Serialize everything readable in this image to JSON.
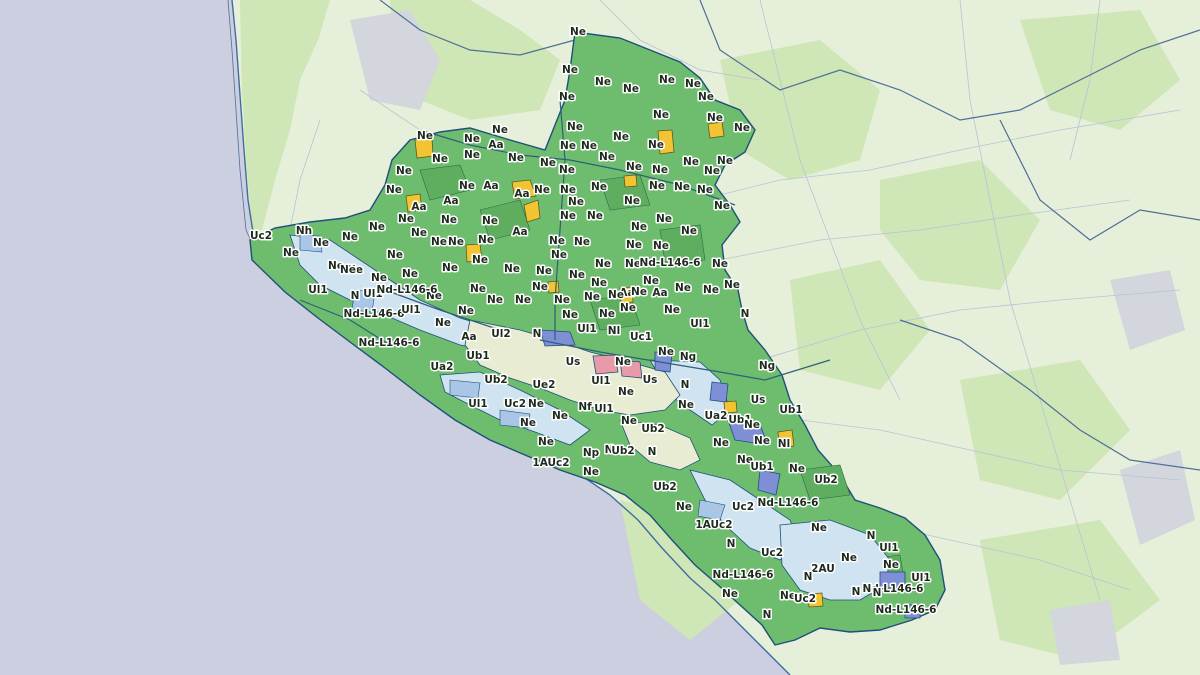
{
  "colors": {
    "sea": "#cbcfdf",
    "land": "#e6efd9",
    "vegetation": "#cfe6b6",
    "zone_N": "#6ebd6e",
    "zone_A": "#f2c433",
    "zone_U_light": "#cfe3f0",
    "zone_U_mid": "#a9c6e6",
    "zone_U_dark": "#7f8fd6",
    "zone_Ub": "#e8ecd2",
    "zone_special": "#e89aa9",
    "boundary": "#1f4f7a"
  },
  "zone_labels": [
    "Ne",
    "Ne",
    "Ne",
    "Ne",
    "Ne",
    "Ne",
    "Ne",
    "Ne",
    "Ne",
    "Ne",
    "Ne",
    "Ne",
    "Ne",
    "Ne",
    "Ne",
    "Ne",
    "Ne",
    "Ne",
    "Ne",
    "Aa",
    "Ne",
    "Ne",
    "Ne",
    "Ne",
    "Ne",
    "Ne",
    "Ne",
    "Ne",
    "Ne",
    "Ne",
    "Ne",
    "Ne",
    "Ne",
    "Aa",
    "Ne",
    "Aa",
    "Ne",
    "Ne",
    "Ne",
    "Aa",
    "Ne",
    "Ne",
    "Ne",
    "Aa",
    "Aa",
    "Ne",
    "Ne",
    "Ne",
    "Ne",
    "Ne",
    "Ne",
    "Ne",
    "Ne",
    "Ne",
    "Ne",
    "Ne",
    "Ne",
    "Ne",
    "Ne",
    "Ne",
    "Ne",
    "Ne",
    "Ne",
    "Ne",
    "Ne",
    "Ne",
    "Ne",
    "Ne",
    "Ne",
    "Ne",
    "Ne",
    "Ne",
    "Nd-L146-6",
    "Ne",
    "Ne",
    "Ne",
    "Ne",
    "Ne",
    "Ne",
    "Ne",
    "Ne",
    "Ne",
    "Ne",
    "Ne",
    "Ne",
    "Ne",
    "Ne",
    "Aa",
    "Ne",
    "Aa",
    "Ne",
    "Ne",
    "Ne",
    "Ne",
    "Ne",
    "Ne",
    "Ne",
    "Ne",
    "Ne",
    "N",
    "Uc2",
    "Nh",
    "Ne",
    "Ne",
    "Ne",
    "Ul1",
    "Ne",
    "Nl",
    "N",
    "Ul1",
    "Nd-L146-6",
    "Ul1",
    "Nd-L146-6",
    "Ne",
    "Ne",
    "Ul1",
    "Ul1",
    "Aa",
    "Ne",
    "Uc1",
    "Ul2",
    "N",
    "Nd-L146-6",
    "Ub1",
    "Us",
    "Ne",
    "Ne",
    "Ng",
    "Ua2",
    "Ue2",
    "Ul1",
    "Us",
    "N",
    "Ng",
    "Ub2",
    "Ne",
    "Us",
    "Ul1",
    "Uc2",
    "Ne",
    "Nf",
    "Ul1",
    "Ne",
    "Ub1",
    "Ne",
    "Ua2",
    "Ne",
    "Ne",
    "Ub1",
    "Ne",
    "Ne",
    "Ub2",
    "Ne",
    "Ne",
    "Nl",
    "N",
    "Ub2",
    "N",
    "Ne",
    "Np",
    "1AUc2",
    "Ub1",
    "Ne",
    "Ne",
    "Ub2",
    "Ub2",
    "Ne",
    "Nd-L146-6",
    "Uc2",
    "1AUc2",
    "Ne",
    "N",
    "Ul1",
    "N",
    "Uc2",
    "Ne",
    "2AU",
    "Nd-L146-6",
    "N",
    "Ne",
    "Ul1",
    "Nd-L146-6",
    "Ne",
    "Ne",
    "Uc2",
    "N",
    "N",
    "N",
    "Nd-L146-6"
  ]
}
